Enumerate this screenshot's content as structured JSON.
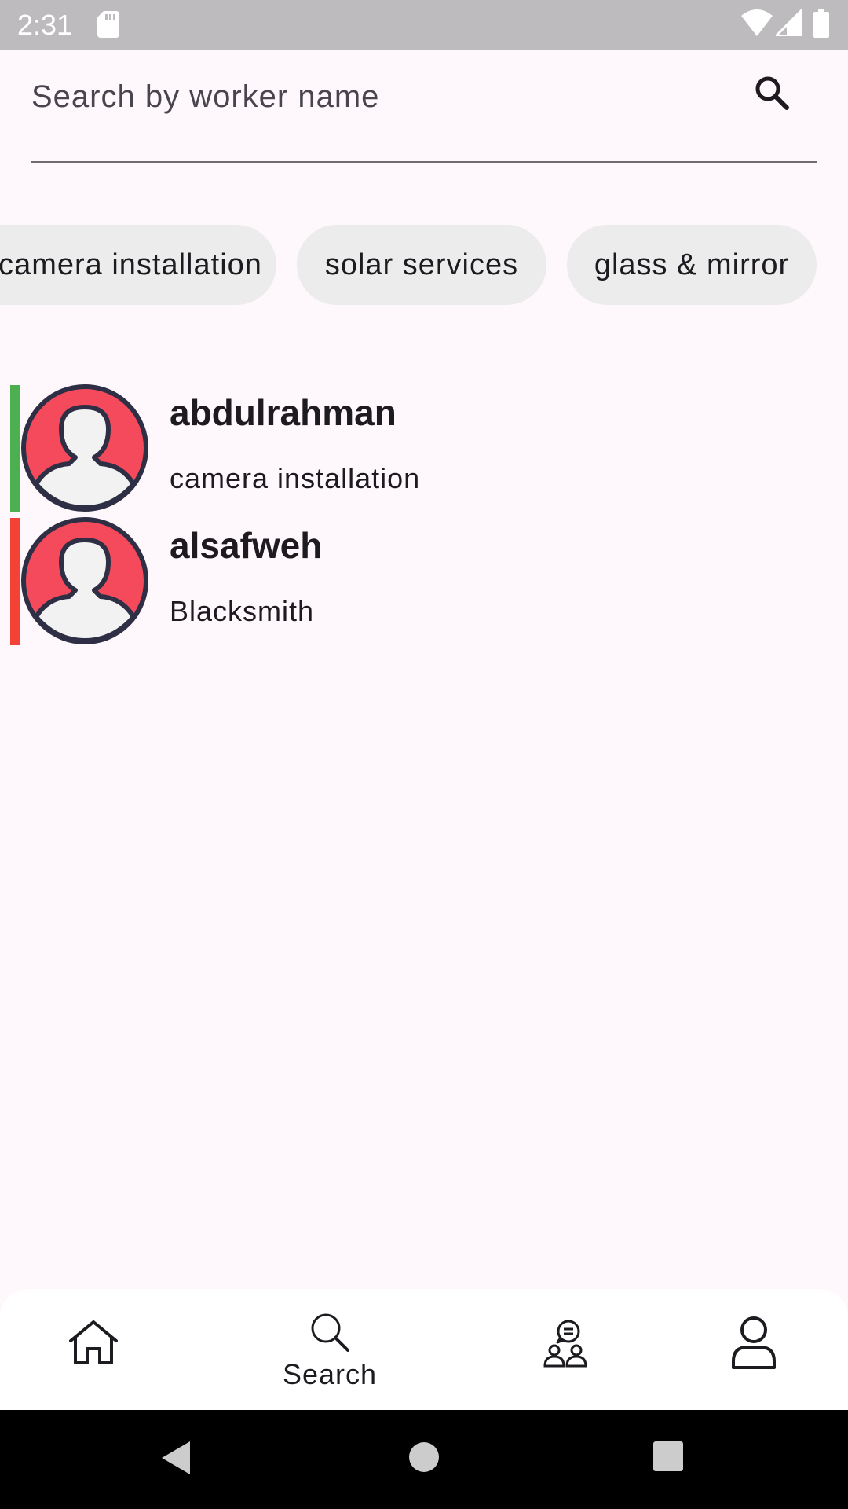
{
  "status_bar": {
    "time": "2:31",
    "icons": [
      "sd-card-icon",
      "wifi-icon",
      "signal-icon",
      "battery-icon"
    ]
  },
  "search": {
    "placeholder": "Search by worker name",
    "value": "",
    "icon": "search-icon"
  },
  "categories": [
    {
      "label": "camera installation"
    },
    {
      "label": "solar services"
    },
    {
      "label": "glass & mirror"
    }
  ],
  "workers": [
    {
      "name": "abdulrahman",
      "job": "camera installation",
      "status_color": "#4caf50",
      "avatar_icon": "user-avatar-icon"
    },
    {
      "name": "alsafweh",
      "job": "Blacksmith",
      "status_color": "#f44336",
      "avatar_icon": "user-avatar-icon"
    }
  ],
  "bottom_nav": {
    "items": [
      {
        "id": "home",
        "label": "",
        "icon": "home-icon"
      },
      {
        "id": "search",
        "label": "Search",
        "icon": "search-icon",
        "selected": true
      },
      {
        "id": "chat",
        "label": "",
        "icon": "chat-group-icon"
      },
      {
        "id": "profile",
        "label": "",
        "icon": "profile-icon"
      }
    ]
  },
  "colors": {
    "background": "#fef7fb",
    "status_bar": "#bdbbbd",
    "chip": "#ececec",
    "avatar_red": "#f44a5b",
    "avatar_outline": "#2e2f45",
    "online": "#4caf50",
    "offline": "#f44336",
    "system_nav": "#000000"
  },
  "system_nav": {
    "buttons": [
      "back-icon",
      "home-circle-icon",
      "recents-icon"
    ]
  }
}
